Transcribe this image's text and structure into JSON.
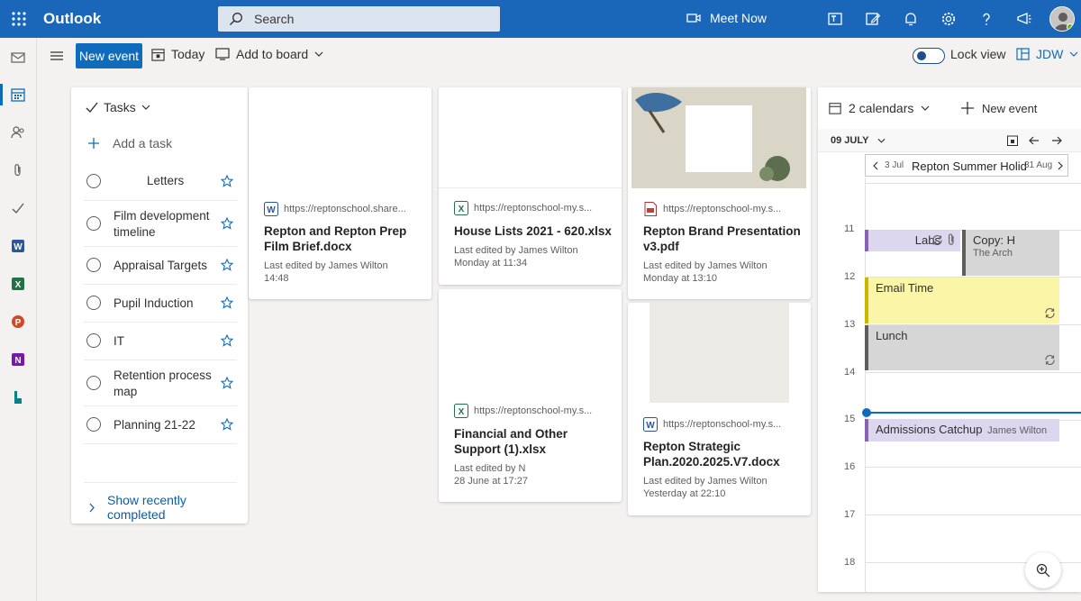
{
  "header": {
    "app_name": "Outlook",
    "search_placeholder": "Search",
    "meet_now": "Meet Now",
    "brand_color": "#1a66b8"
  },
  "commands": {
    "new_event": "New event",
    "today": "Today",
    "add_to_board": "Add to board",
    "lock_view": "Lock view",
    "board_name": "JDW"
  },
  "tasks": {
    "title": "Tasks",
    "add_task": "Add a task",
    "items": [
      {
        "label": "Letters"
      },
      {
        "label": "Film development timeline"
      },
      {
        "label": "Appraisal Targets"
      },
      {
        "label": "Pupil Induction"
      },
      {
        "label": "IT"
      },
      {
        "label": "Retention process map"
      },
      {
        "label": "Planning 21-22"
      }
    ],
    "show_completed": "Show recently completed"
  },
  "files": [
    {
      "url": "https://reptonschool.share...",
      "name": "Repton and Repton Prep Film Brief.docx",
      "edited_by": "Last edited by James Wilton",
      "edited_when": "14:48",
      "type": "word"
    },
    {
      "url": "https://reptonschool-my.s...",
      "name": "House Lists 2021 - 620.xlsx",
      "edited_by": "Last edited by James Wilton",
      "edited_when": "Monday at 11:34",
      "type": "excel"
    },
    {
      "url": "https://reptonschool-my.s...",
      "name": "Repton Brand Presentation v3.pdf",
      "edited_by": "Last edited by James Wilton",
      "edited_when": "Monday at 13:10",
      "type": "pdf"
    },
    {
      "url": "https://reptonschool-my.s...",
      "name": "Financial and Other Support (1).xlsx",
      "edited_by": "Last edited by N",
      "edited_when": "28 June at 17:27",
      "type": "excel"
    },
    {
      "url": "https://reptonschool-my.s...",
      "name": "Repton Strategic Plan.2020.2025.V7.docx",
      "edited_by": "Last edited by James Wilton",
      "edited_when": "Yesterday at 22:10",
      "type": "word"
    }
  ],
  "calendar": {
    "calendars_label": "2 calendars",
    "new_event": "New event",
    "date_label": "09 JULY",
    "allday_start": "3 Jul",
    "allday_title": "Repton Summer Holid",
    "allday_end": "31 Aug",
    "hours": [
      "11",
      "12",
      "13",
      "14",
      "15",
      "16",
      "17",
      "18"
    ],
    "events": [
      {
        "title": "Labs"
      },
      {
        "title": "Copy: H",
        "location": "The Arch"
      },
      {
        "title": "Email Time"
      },
      {
        "title": "Lunch"
      },
      {
        "title": "Admissions Catchup",
        "organizer": "James Wilton"
      }
    ]
  },
  "colors": {
    "accent": "#0f6cbd",
    "event_purple": "#dcd6ef",
    "event_yellow": "#fbf5a8",
    "event_grey": "#d6d6d6"
  }
}
